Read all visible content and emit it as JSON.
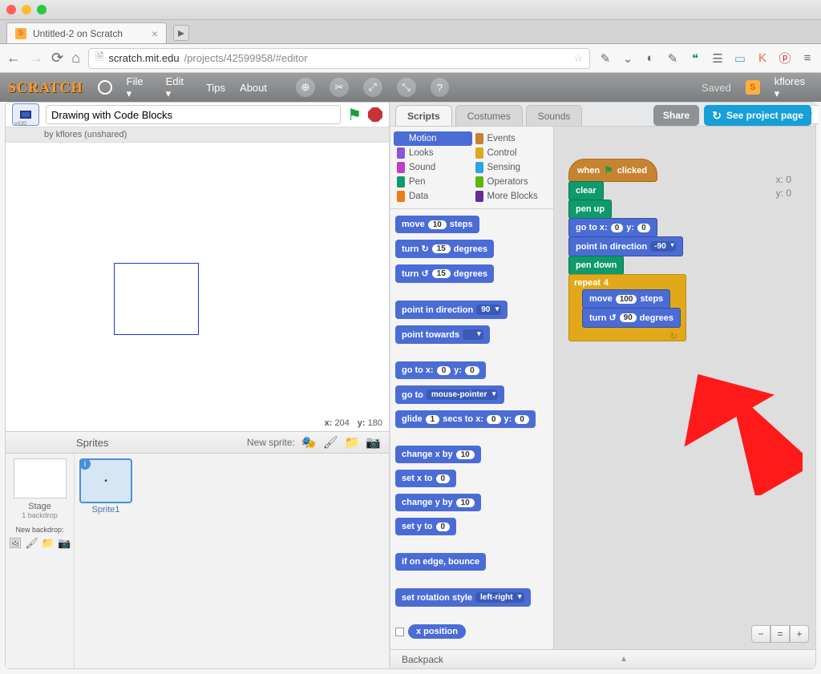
{
  "browser": {
    "tab_title": "Untitled-2 on Scratch",
    "url_host": "scratch.mit.edu",
    "url_path": "/projects/42599958/#editor",
    "star_icon": "star-icon"
  },
  "menu": {
    "logo": "SCRATCH",
    "file": "File ▾",
    "edit": "Edit ▾",
    "tips": "Tips",
    "about": "About",
    "saved": "Saved",
    "user": "kflores ▾"
  },
  "buttons": {
    "share": "Share",
    "see_page": "See project page"
  },
  "project": {
    "version": "v430",
    "title": "Drawing with Code Blocks",
    "byline": "by kflores (unshared)"
  },
  "stage": {
    "x_label": "x:",
    "x_val": "204",
    "y_label": "y:",
    "y_val": "180",
    "sprites_label": "Sprites",
    "new_sprite": "New sprite:",
    "stage_lbl": "Stage",
    "backdrop_count": "1 backdrop",
    "new_backdrop": "New backdrop:",
    "sprite1": "Sprite1"
  },
  "tabs": {
    "scripts": "Scripts",
    "costumes": "Costumes",
    "sounds": "Sounds"
  },
  "categories": {
    "motion": "Motion",
    "looks": "Looks",
    "sound": "Sound",
    "pen": "Pen",
    "data": "Data",
    "events": "Events",
    "control": "Control",
    "sensing": "Sensing",
    "operators": "Operators",
    "more": "More Blocks"
  },
  "coord_readout": {
    "x": "x: 0",
    "y": "y: 0"
  },
  "palette": {
    "move": "move",
    "move_v": "10",
    "steps": "steps",
    "turn_cw": "turn ↻",
    "turn_cw_v": "15",
    "degrees": "degrees",
    "turn_ccw": "turn ↺",
    "turn_ccw_v": "15",
    "point_dir": "point in direction",
    "point_dir_v": "90",
    "point_tw": "point towards",
    "goto_xy": "go to x:",
    "goto_x": "0",
    "goto_yl": "y:",
    "goto_y": "0",
    "goto": "go to",
    "goto_v": "mouse-pointer",
    "glide": "glide",
    "glide_s": "1",
    "glide_mid": "secs to x:",
    "glide_x": "0",
    "glide_yl": "y:",
    "glide_y": "0",
    "chx": "change x by",
    "chx_v": "10",
    "setx": "set x to",
    "setx_v": "0",
    "chy": "change y by",
    "chy_v": "10",
    "sety": "set y to",
    "sety_v": "0",
    "edge": "if on edge, bounce",
    "rot": "set rotation style",
    "rot_v": "left-right",
    "xpos": "x position"
  },
  "script": {
    "hat_when": "when",
    "hat_clicked": "clicked",
    "clear": "clear",
    "penup": "pen up",
    "goto": "go to x:",
    "gx": "0",
    "gy_l": "y:",
    "gy": "0",
    "pid": "point in direction",
    "pid_v": "-90",
    "pendown": "pen down",
    "repeat": "repeat",
    "repeat_v": "4",
    "move": "move",
    "move_v": "100",
    "steps": "steps",
    "turn": "turn ↺",
    "turn_v": "90",
    "degrees": "degrees"
  },
  "backpack": "Backpack"
}
